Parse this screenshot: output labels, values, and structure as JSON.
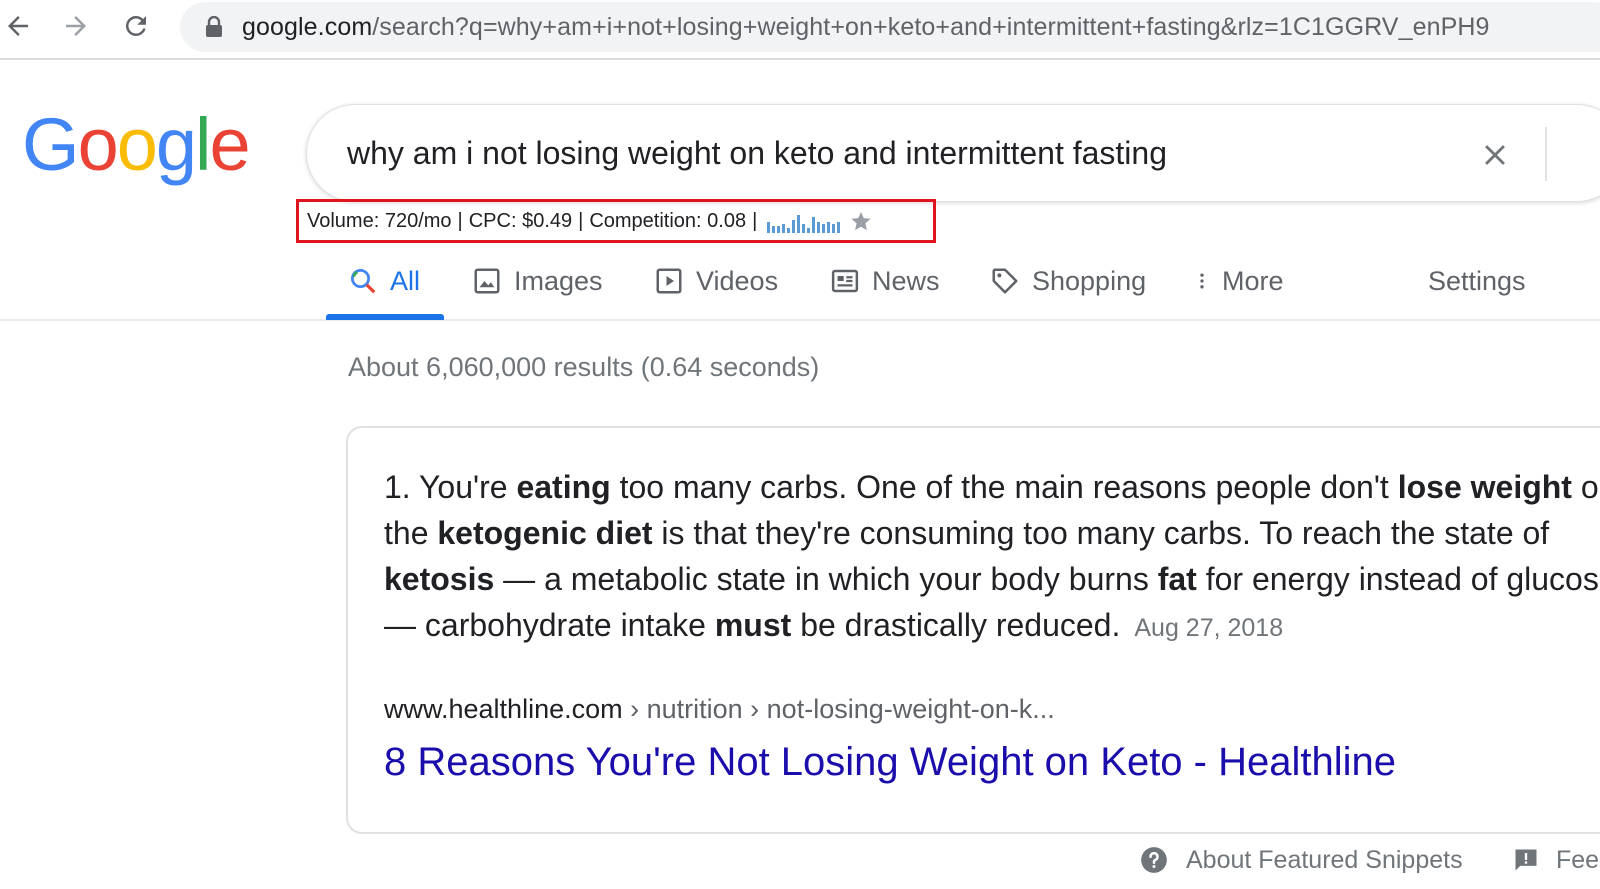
{
  "browser": {
    "url_domain": "google.com",
    "url_rest": "/search?q=why+am+i+not+losing+weight+on+keto+and+intermittent+fasting&rlz=1C1GGRV_enPH9",
    "icons": [
      "back-arrow-icon",
      "forward-arrow-icon",
      "reload-icon",
      "lock-icon"
    ]
  },
  "logo": {
    "letters": [
      "G",
      "o",
      "o",
      "g",
      "l",
      "e"
    ],
    "colors": [
      "#4285f4",
      "#ea4335",
      "#fbbc05",
      "#4285f4",
      "#34a853",
      "#ea4335"
    ]
  },
  "search": {
    "query": "why am i not losing weight on keto and intermittent fasting"
  },
  "metrics": {
    "volume": "Volume: 720/mo",
    "cpc": "CPC: $0.49",
    "competition": "Competition: 0.08",
    "separator": "|",
    "trend_levels": [
      0.6,
      0.4,
      0.4,
      0.5,
      0.3,
      0.7,
      1.0,
      0.5,
      0.3,
      0.9,
      0.6,
      0.5,
      0.6,
      0.5,
      0.6
    ],
    "border_color": "#e0141e"
  },
  "tabs": [
    {
      "label": "All",
      "icon": "search-icon",
      "active": true
    },
    {
      "label": "Images",
      "icon": "image-icon"
    },
    {
      "label": "Videos",
      "icon": "video-icon"
    },
    {
      "label": "News",
      "icon": "news-icon"
    },
    {
      "label": "Shopping",
      "icon": "tag-icon"
    },
    {
      "label": "More",
      "icon": "more-vert-icon"
    },
    {
      "label": "Settings"
    }
  ],
  "results": {
    "count_text": "About 6,060,000 results (0.64 seconds)"
  },
  "snippet": {
    "lines": [
      [
        {
          "t": "1. You're "
        },
        {
          "t": "eating",
          "b": true
        },
        {
          "t": " too many carbs. One of the main reasons people don't "
        },
        {
          "t": "lose weight",
          "b": true
        },
        {
          "t": " on"
        }
      ],
      [
        {
          "t": "the "
        },
        {
          "t": "ketogenic diet",
          "b": true
        },
        {
          "t": " is that they're consuming too many carbs. To reach the state of"
        }
      ],
      [
        {
          "t": "ketosis",
          "b": true
        },
        {
          "t": " — a metabolic state in which your body burns "
        },
        {
          "t": "fat",
          "b": true
        },
        {
          "t": " for energy instead of glucose"
        }
      ],
      [
        {
          "t": "— carbohydrate intake "
        },
        {
          "t": "must",
          "b": true
        },
        {
          "t": " be drastically reduced."
        }
      ]
    ],
    "date": "Aug 27, 2018",
    "cite_domain": "www.healthline.com",
    "cite_crumbs": " › nutrition › not-losing-weight-on-k...",
    "title": "8 Reasons You're Not Losing Weight on Keto - Healthline"
  },
  "footer": {
    "about_label": "About Featured Snippets",
    "feedback_label": "Feedback"
  }
}
